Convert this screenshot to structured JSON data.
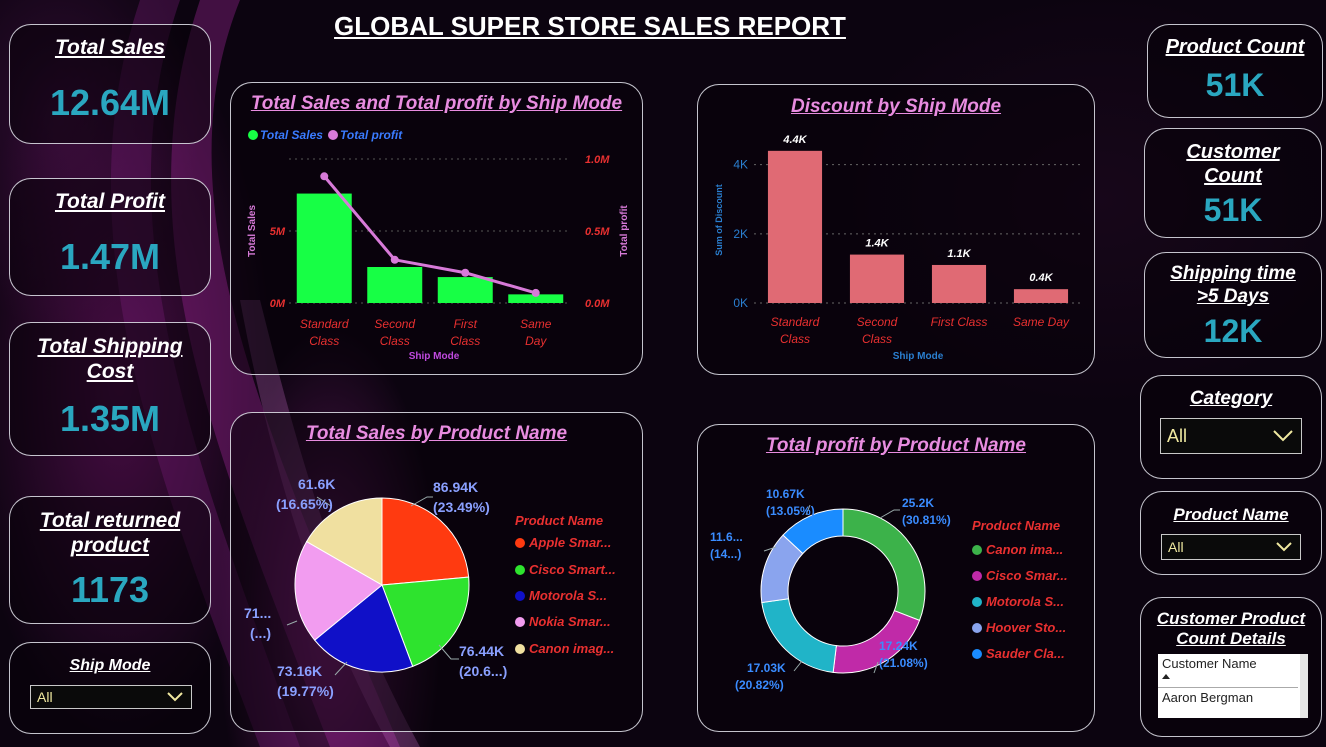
{
  "report_title": "GLOBAL SUPER STORE SALES REPORT",
  "kpis_left": [
    {
      "title": "Total Sales",
      "value": "12.64M"
    },
    {
      "title": "Total Profit",
      "value": "1.47M"
    },
    {
      "title_line1": "Total Shipping",
      "title_line2": "Cost",
      "value": "1.35M"
    },
    {
      "title_line1": "Total returned",
      "title_line2": "product",
      "value": "1173"
    }
  ],
  "kpis_right": [
    {
      "title": "Product Count",
      "value": "51K"
    },
    {
      "title_line1": "Customer",
      "title_line2": "Count",
      "value": "51K"
    },
    {
      "title_line1": "Shipping time",
      "title_line2": ">5 Days",
      "value": "12K"
    }
  ],
  "slicers": {
    "ship_mode": {
      "title": "Ship Mode",
      "value": "All"
    },
    "category": {
      "title": "Category",
      "value": "All"
    },
    "product_name": {
      "title": "Product Name",
      "value": "All"
    }
  },
  "customer_table": {
    "title_line1": "Customer Product",
    "title_line2": "Count Details",
    "header": "Customer Name",
    "rows": [
      "Aaron Bergman"
    ]
  },
  "colors": {
    "accent": "#2aa7c0",
    "chart_title": "#e88ce0",
    "sales_bar": "#17ff45",
    "profit_line": "#d77ad8",
    "discount_bar": "#e06a74",
    "axis_label_red": "#e83030"
  },
  "chart_data": [
    {
      "type": "bar",
      "title": "Total Sales and Total profit by Ship Mode",
      "legend": [
        "Total Sales",
        "Total profit"
      ],
      "categories": [
        "Standard Class",
        "Second Class",
        "First Class",
        "Same Day"
      ],
      "category_lines": [
        [
          "Standard",
          "Class"
        ],
        [
          "Second",
          "Class"
        ],
        [
          "First",
          "Class"
        ],
        [
          "Same",
          "Day"
        ]
      ],
      "xlabel": "Ship Mode",
      "ylabel": "Total Sales",
      "y2label": "Total profit",
      "y_ticks": [
        "0M",
        "5M"
      ],
      "y2_ticks": [
        "0.0M",
        "0.5M",
        "1.0M"
      ],
      "ylim": [
        0,
        10
      ],
      "y2lim": [
        0,
        1.0
      ],
      "series": [
        {
          "name": "Total Sales",
          "type": "bar",
          "values": [
            7.6,
            2.5,
            1.8,
            0.6
          ]
        },
        {
          "name": "Total profit",
          "type": "line",
          "values": [
            0.88,
            0.3,
            0.21,
            0.07
          ]
        }
      ]
    },
    {
      "type": "bar",
      "title": "Discount by Ship Mode",
      "categories": [
        "Standard Class",
        "Second Class",
        "First Class",
        "Same Day"
      ],
      "category_lines": [
        [
          "Standard",
          "Class"
        ],
        [
          "Second",
          "Class"
        ],
        [
          "First Class"
        ],
        [
          "Same Day"
        ]
      ],
      "xlabel": "Ship Mode",
      "ylabel": "Sum of Discount",
      "y_ticks": [
        "0K",
        "2K",
        "4K"
      ],
      "ylim": [
        0,
        4.8
      ],
      "values": [
        4.4,
        1.4,
        1.1,
        0.4
      ],
      "data_labels": [
        "4.4K",
        "1.4K",
        "1.1K",
        "0.4K"
      ]
    },
    {
      "type": "pie",
      "title": "Total Sales by Product Name",
      "legend_title": "Product Name",
      "legend": [
        "Apple Smar...",
        "Cisco Smart...",
        "Motorola S...",
        "Nokia Smar...",
        "Canon imag..."
      ],
      "values": [
        86.94,
        76.44,
        73.16,
        71,
        61.6
      ],
      "colors": [
        "#ff3a10",
        "#2ee32e",
        "#1010c8",
        "#f29cf0",
        "#f0e0a0"
      ],
      "data_labels": [
        [
          "86.94K",
          "(23.49%)"
        ],
        [
          "76.44K",
          "(20.6...)"
        ],
        [
          "73.16K",
          "(19.77%)"
        ],
        [
          "71...",
          "(...)"
        ],
        [
          "61.6K",
          "(16.65%)"
        ]
      ]
    },
    {
      "type": "pie",
      "title": "Total profit by Product Name",
      "legend_title": "Product Name",
      "legend": [
        "Canon ima...",
        "Cisco Smar...",
        "Motorola S...",
        "Hoover Sto...",
        "Sauder Cla..."
      ],
      "values": [
        25.2,
        17.24,
        17.03,
        11.6,
        10.67
      ],
      "colors": [
        "#3cb24a",
        "#c02aa8",
        "#20b4c8",
        "#8aa4ee",
        "#1a8cff"
      ],
      "data_labels": [
        [
          "25.2K",
          "(30.81%)"
        ],
        [
          "17.24K",
          "(21.08%)"
        ],
        [
          "17.03K",
          "(20.82%)"
        ],
        [
          "11.6...",
          "(14...)"
        ],
        [
          "10.67K",
          "(13.05%)"
        ]
      ]
    }
  ]
}
